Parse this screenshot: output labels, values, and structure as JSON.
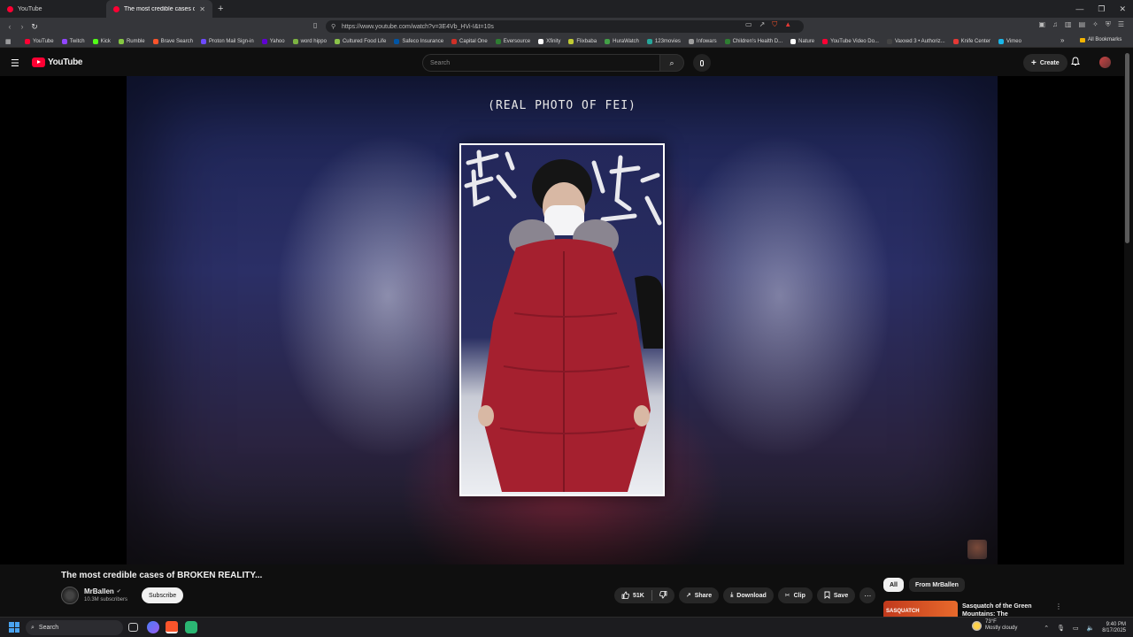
{
  "browser": {
    "tabs": [
      {
        "label": "YouTube",
        "active": false
      },
      {
        "label": "The most credible cases of B",
        "active": true
      }
    ],
    "new_tab_label": "+",
    "url": "https://www.youtube.com/watch?v=3E4Vb_HVi-I&t=10s",
    "bookmarks": [
      {
        "label": "YouTube",
        "color": "#ff0033"
      },
      {
        "label": "Twitch",
        "color": "#9146ff"
      },
      {
        "label": "Kick",
        "color": "#53fc18"
      },
      {
        "label": "Rumble",
        "color": "#85c742"
      },
      {
        "label": "Brave Search",
        "color": "#fb542b"
      },
      {
        "label": "Proton Mail Sign-in",
        "color": "#6d4aff"
      },
      {
        "label": "Yahoo",
        "color": "#6001d2"
      },
      {
        "label": "word hippo",
        "color": "#7cb342"
      },
      {
        "label": "Cultured Food Life",
        "color": "#8bc34a"
      },
      {
        "label": "Safeco Insurance",
        "color": "#0055a5"
      },
      {
        "label": "Capital One",
        "color": "#d03027"
      },
      {
        "label": "Eversource",
        "color": "#2e7d32"
      },
      {
        "label": "Xfinity",
        "color": "#ffffff"
      },
      {
        "label": "Flixbaba",
        "color": "#c0ca33"
      },
      {
        "label": "HuraWatch",
        "color": "#43a047"
      },
      {
        "label": "123movies",
        "color": "#26a69a"
      },
      {
        "label": "Infowars",
        "color": "#9e9e9e"
      },
      {
        "label": "Children's Health D...",
        "color": "#2e7d32"
      },
      {
        "label": "Nature",
        "color": "#ffffff"
      },
      {
        "label": "YouTube Video Do...",
        "color": "#ff0033"
      },
      {
        "label": "Vaxxed 3 • Authoriz...",
        "color": "#444444"
      },
      {
        "label": "Knife Center",
        "color": "#e53935"
      },
      {
        "label": "Vimeo",
        "color": "#1ab7ea"
      }
    ],
    "bookmarks_more": "»",
    "all_bookmarks": "All Bookmarks"
  },
  "youtube": {
    "logo_text": "YouTube",
    "search_placeholder": "Search",
    "create_label": "Create"
  },
  "video": {
    "caption": "(REAL PHOTO OF FEI)",
    "title": "The most credible cases of BROKEN REALITY...",
    "channel_name": "MrBallen",
    "verified_glyph": "✔",
    "subscribers": "10.3M subscribers",
    "subscribe_label": "Subscribe",
    "likes": "51K",
    "share_label": "Share",
    "download_label": "Download",
    "clip_label": "Clip",
    "save_label": "Save"
  },
  "sidebar": {
    "chips": [
      {
        "label": "All",
        "active": true
      },
      {
        "label": "From MrBallen",
        "active": false
      }
    ],
    "recommendation": {
      "thumb_text": "SASQUATCH",
      "title": "Sasquatch of the Green Mountains: The Appalachian..."
    }
  },
  "taskbar": {
    "search_label": "Search",
    "weather_temp": "73°F",
    "weather_desc": "Mostly cloudy",
    "time": "9:40 PM",
    "date": "8/17/2025"
  },
  "icons": {
    "menu": "☰",
    "search": "⌕",
    "mic": "🎙",
    "bell": "🔔",
    "plus": "+",
    "like": "👍",
    "dislike": "👎",
    "share": "↗",
    "download": "⤓",
    "clip": "✂",
    "save": "🔖",
    "more": "⋯",
    "kebab": "⋮"
  }
}
